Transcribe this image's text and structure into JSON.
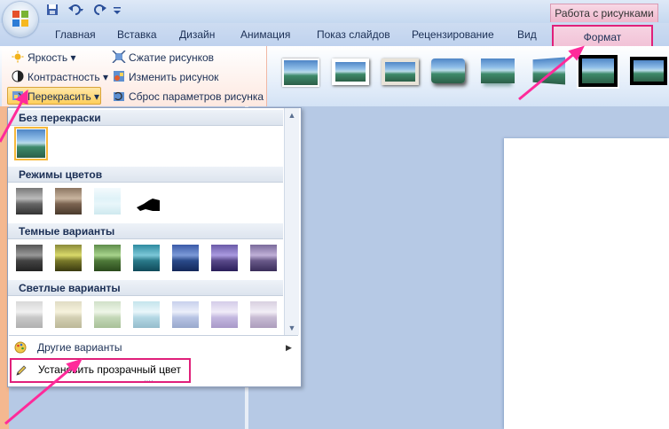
{
  "window": {
    "context_title": "Работа с рисунками"
  },
  "tabs": [
    {
      "label": "Главная"
    },
    {
      "label": "Вставка"
    },
    {
      "label": "Дизайн"
    },
    {
      "label": "Анимация"
    },
    {
      "label": "Показ слайдов"
    },
    {
      "label": "Рецензирование"
    },
    {
      "label": "Вид"
    },
    {
      "label": "Формат"
    }
  ],
  "ribbon": {
    "adjust": {
      "brightness": "Яркость",
      "contrast": "Контрастность",
      "recolor": "Перекрасить",
      "compress": "Сжатие рисунков",
      "change": "Изменить рисунок",
      "reset": "Сброс параметров рисунка"
    }
  },
  "dropdown": {
    "sections": [
      {
        "title": "Без перекраски"
      },
      {
        "title": "Режимы цветов"
      },
      {
        "title": "Темные варианты"
      },
      {
        "title": "Светлые варианты"
      }
    ],
    "more_variants": "Другие варианты",
    "set_transparent": "Установить прозрачный цвет"
  },
  "colors": {
    "highlight": "#e0207a",
    "accent": "#ffcf5c"
  },
  "icons": [
    "office-logo-icon",
    "save-icon",
    "undo-icon",
    "redo-icon",
    "brightness-icon",
    "contrast-icon",
    "recolor-icon",
    "compress-icon",
    "change-picture-icon",
    "reset-picture-icon",
    "palette-icon",
    "pen-icon",
    "chevron-right-icon"
  ]
}
